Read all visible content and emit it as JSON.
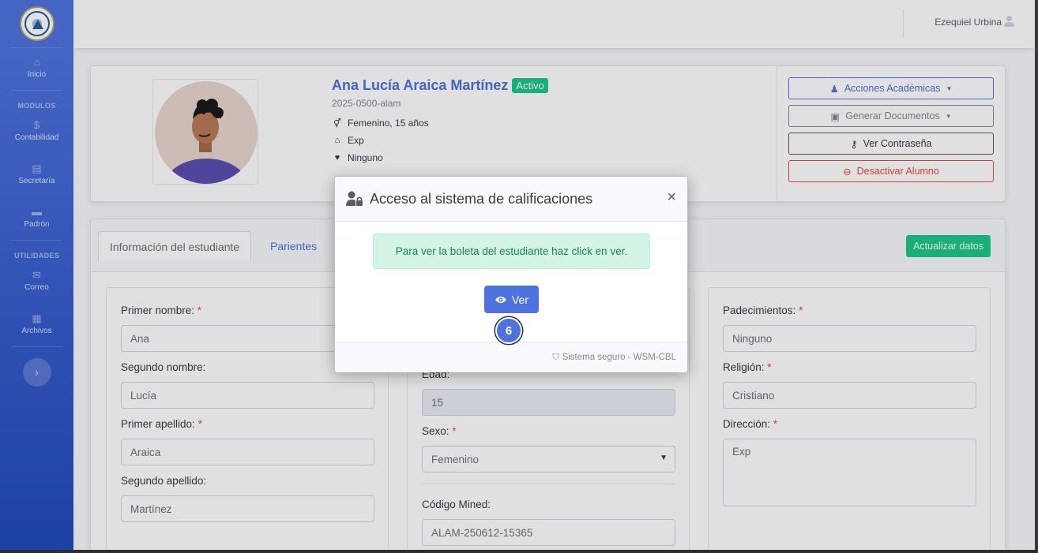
{
  "user": {
    "name": "Ezequiel Urbina"
  },
  "sidebar": {
    "items": [
      {
        "label": "Inicio",
        "icon": "home-icon",
        "glyph": "⌂"
      },
      {
        "heading": "MODULOS"
      },
      {
        "label": "Contabilidad",
        "icon": "dollar-icon",
        "glyph": "$"
      },
      {
        "label": "Secretaría",
        "icon": "receipt-icon",
        "glyph": "▤"
      },
      {
        "label": "Padrón",
        "icon": "folder-icon",
        "glyph": "▬"
      },
      {
        "heading": "UTILIDADES"
      },
      {
        "label": "Correo",
        "icon": "envelope-icon",
        "glyph": "✉"
      },
      {
        "label": "Archivos",
        "icon": "archive-icon",
        "glyph": "▦"
      }
    ]
  },
  "student": {
    "name": "Ana Lucía Araica Martínez",
    "status": "Activo",
    "id": "2025-0500-alam",
    "gender_age": "Femenino, 15 años",
    "address": "Exp",
    "ailments": "Ninguno"
  },
  "actions": {
    "academic": "Acciones Académicas",
    "documents": "Generar Documentos",
    "password": "Ver Contraseña",
    "deactivate": "Desactivar Alumno"
  },
  "tabs": {
    "info": "Información del estudiante",
    "parents": "Parientes"
  },
  "update_button": "Actualizar datos",
  "form": {
    "first_name": {
      "label": "Primer nombre:",
      "value": "Ana"
    },
    "second_name": {
      "label": "Segundo nombre:",
      "value": "Lucía"
    },
    "first_surname": {
      "label": "Primer apellido:",
      "value": "Araica"
    },
    "second_surname": {
      "label": "Segundo apellido:",
      "value": "Martínez"
    },
    "age": {
      "label": "Edad:",
      "value": "15"
    },
    "sex": {
      "label": "Sexo:",
      "value": "Femenino"
    },
    "mined": {
      "label": "Código Mined:",
      "value": "ALAM-250612-15365"
    },
    "ailments": {
      "label": "Padecimientos:",
      "value": "Ninguno"
    },
    "religion": {
      "label": "Religión:",
      "value": "Cristiano"
    },
    "address": {
      "label": "Dirección:",
      "value": "Exp"
    },
    "required_mark": "*"
  },
  "modal": {
    "title": "Acceso al sistema de calificaciones",
    "close": "×",
    "message": "Para ver la boleta del estudiante haz click en ver.",
    "button": "Ver",
    "step_marker": "6",
    "footer": "Sistema seguro - WSM-CBL"
  },
  "colors": {
    "primary": "#4e73df",
    "success": "#1cc88a",
    "danger": "#e74a3b"
  }
}
